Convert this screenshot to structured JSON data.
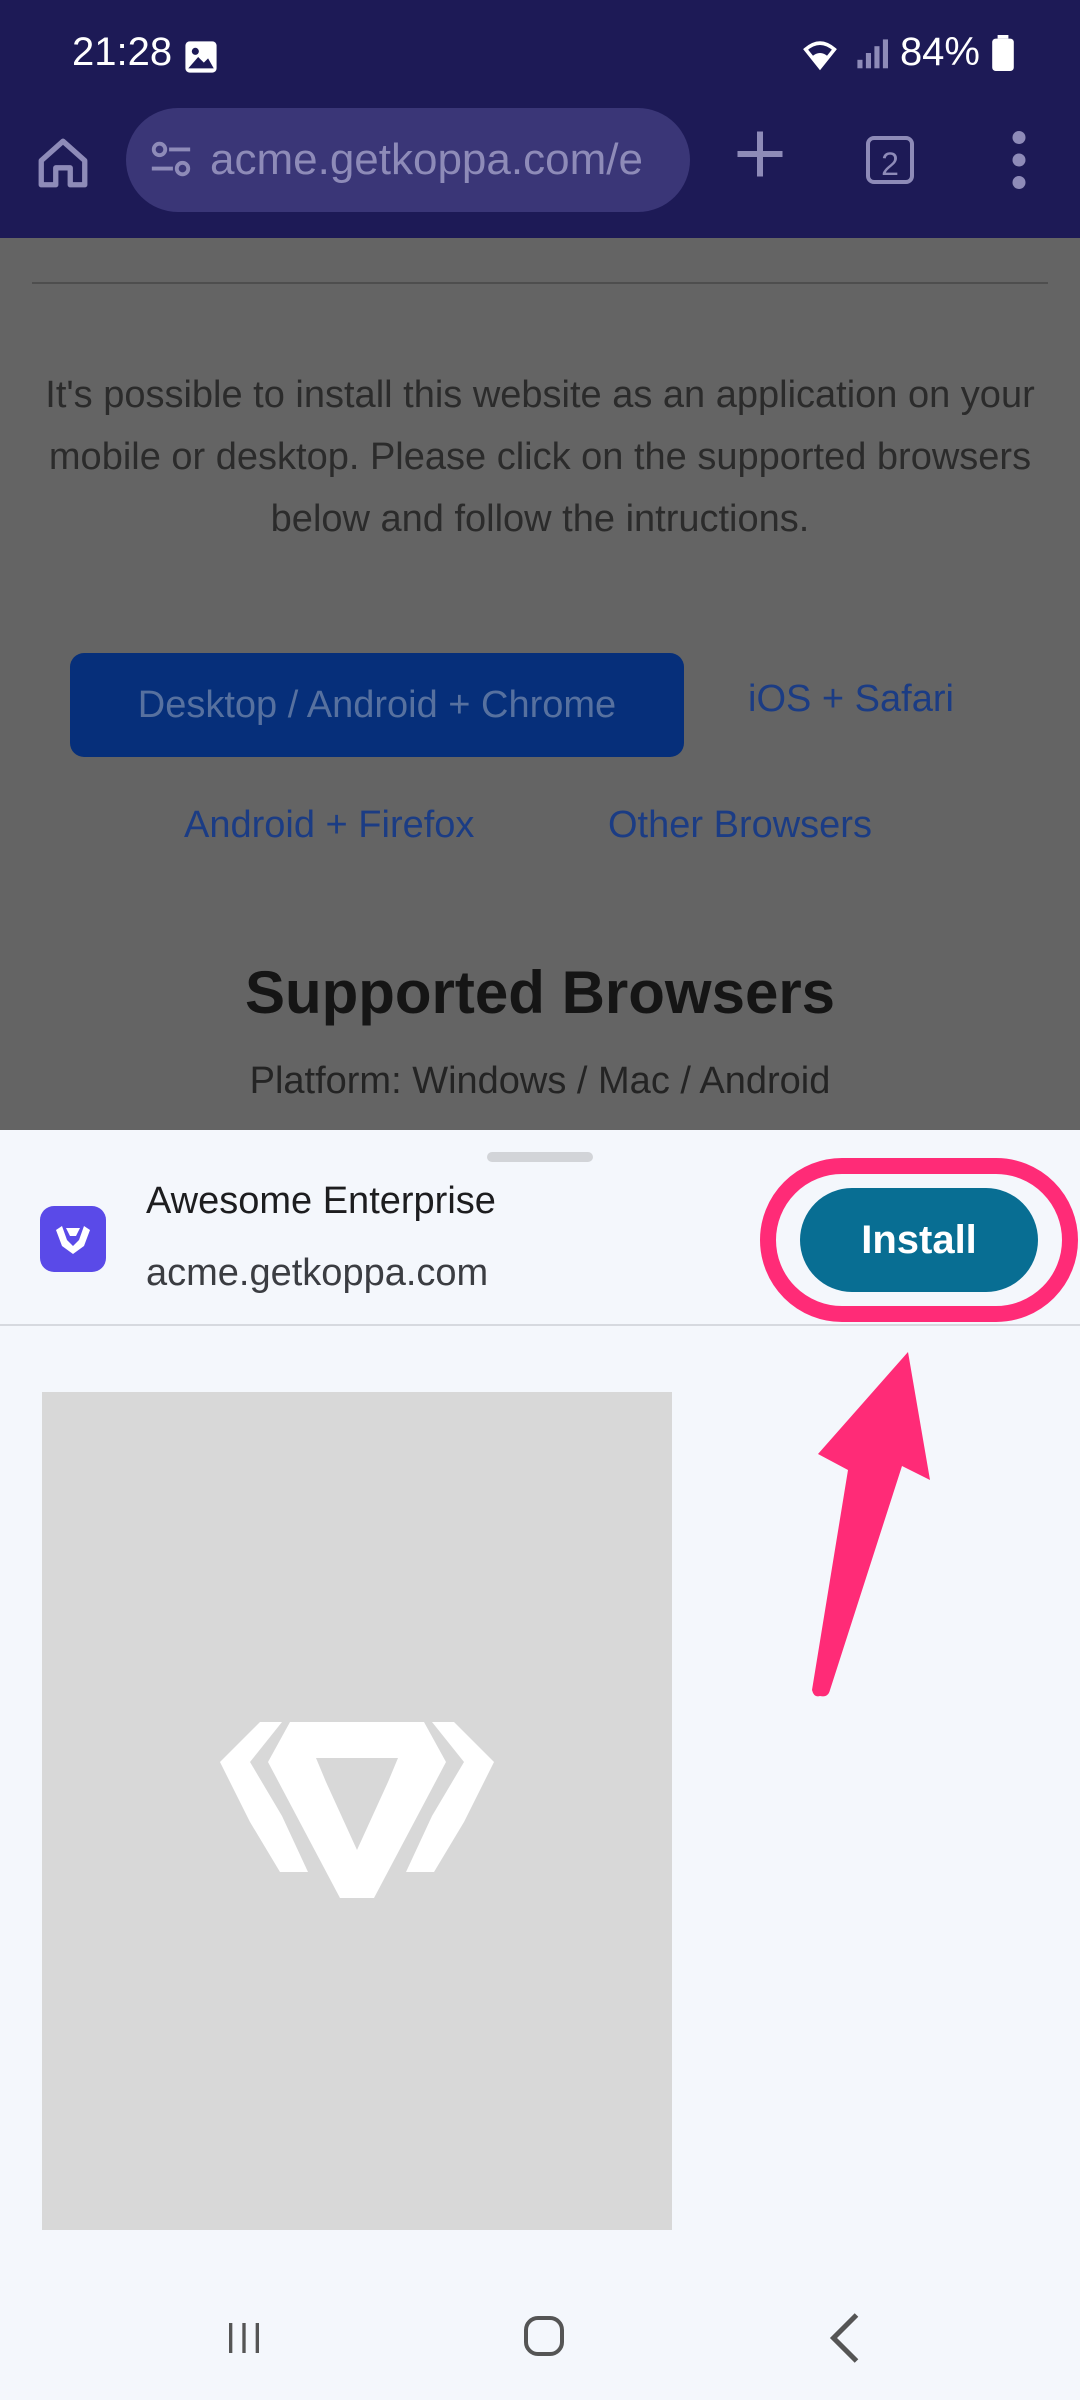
{
  "status_bar": {
    "time": "21:28",
    "battery": "84%"
  },
  "browser": {
    "url": "acme.getkoppa.com/e",
    "tab_count": "2"
  },
  "page": {
    "intro_text": "It's possible to install this website as an application on your mobile or desktop. Please click on the supported browsers below and follow the intructions.",
    "tabs": [
      {
        "label": "Desktop / Android + Chrome"
      },
      {
        "label": "iOS + Safari"
      },
      {
        "label": "Android + Firefox"
      },
      {
        "label": "Other Browsers"
      }
    ],
    "heading": "Supported Browsers",
    "platform": "Platform: Windows / Mac / Android"
  },
  "install_sheet": {
    "app_name": "Awesome Enterprise",
    "app_url": "acme.getkoppa.com",
    "install_label": "Install"
  },
  "colors": {
    "highlight": "#ff2b77",
    "install": "#086e93",
    "chrome": "#1d1a56"
  }
}
